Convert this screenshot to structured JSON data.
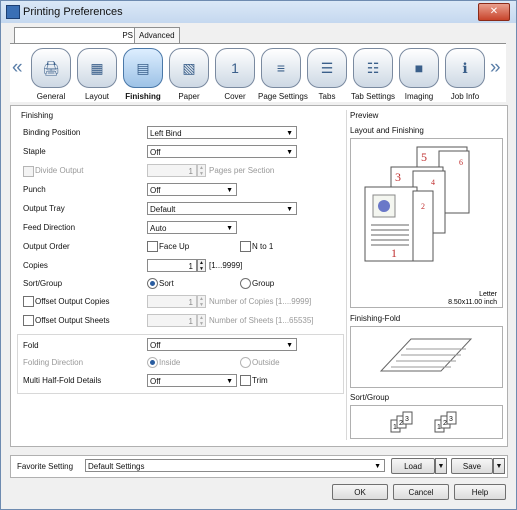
{
  "window": {
    "title": "Printing Preferences",
    "close": "✕"
  },
  "tabs": {
    "main": "PS",
    "advanced": "Advanced"
  },
  "icon_tabs": [
    {
      "label": "General",
      "glyph": "🖨"
    },
    {
      "label": "Layout",
      "glyph": "▦"
    },
    {
      "label": "Finishing",
      "glyph": "▤"
    },
    {
      "label": "Paper",
      "glyph": "▧"
    },
    {
      "label": "Cover",
      "glyph": "1"
    },
    {
      "label": "Page Settings",
      "glyph": "≡"
    },
    {
      "label": "Tabs",
      "glyph": "☰"
    },
    {
      "label": "Tab Settings",
      "glyph": "☷"
    },
    {
      "label": "Imaging",
      "glyph": "■"
    },
    {
      "label": "Job Info",
      "glyph": "ℹ"
    }
  ],
  "nav": {
    "prev": "«",
    "next": "»"
  },
  "finishing": {
    "group": "Finishing",
    "binding_position": {
      "label": "Binding Position",
      "value": "Left Bind"
    },
    "staple": {
      "label": "Staple",
      "value": "Off"
    },
    "divide_output": {
      "label": "Divide Output",
      "value": "1",
      "suffix": "Pages per Section"
    },
    "punch": {
      "label": "Punch",
      "value": "Off"
    },
    "output_tray": {
      "label": "Output Tray",
      "value": "Default"
    },
    "feed_direction": {
      "label": "Feed Direction",
      "value": "Auto"
    },
    "output_order": {
      "label": "Output Order",
      "face_up": "Face Up",
      "n_to_1": "N to 1"
    },
    "copies": {
      "label": "Copies",
      "value": "1",
      "range": "[1...9999]"
    },
    "sort_group": {
      "label": "Sort/Group",
      "sort": "Sort",
      "group": "Group"
    },
    "offset_copies": {
      "label": "Offset Output Copies",
      "value": "1",
      "suffix": "Number of Copies [1....9999]"
    },
    "offset_sheets": {
      "label": "Offset Output Sheets",
      "value": "1",
      "suffix": "Number of Sheets [1...65535]"
    },
    "fold": {
      "label": "Fold",
      "value": "Off"
    },
    "folding_direction": {
      "label": "Folding Direction",
      "inside": "Inside",
      "outside": "Outside"
    },
    "multi_half_fold": {
      "label": "Multi Half-Fold Details",
      "value": "Off",
      "trim": "Trim"
    }
  },
  "preview": {
    "title": "Preview",
    "layout_finishing": "Layout and Finishing",
    "paper_name": "Letter",
    "paper_size": "8.50x11.00 inch",
    "pages": [
      "1",
      "2",
      "3",
      "4",
      "5",
      "6"
    ],
    "finishing_fold": "Finishing-Fold",
    "sort_group": "Sort/Group",
    "sort_digits": [
      "1",
      "2",
      "3",
      "1",
      "2",
      "3"
    ]
  },
  "favorite": {
    "label": "Favorite Setting",
    "value": "Default Settings",
    "load": "Load",
    "save": "Save"
  },
  "buttons": {
    "ok": "OK",
    "cancel": "Cancel",
    "help": "Help"
  },
  "icons": {
    "dropdown": "▼",
    "spin_up": "▲",
    "spin_down": "▼"
  }
}
